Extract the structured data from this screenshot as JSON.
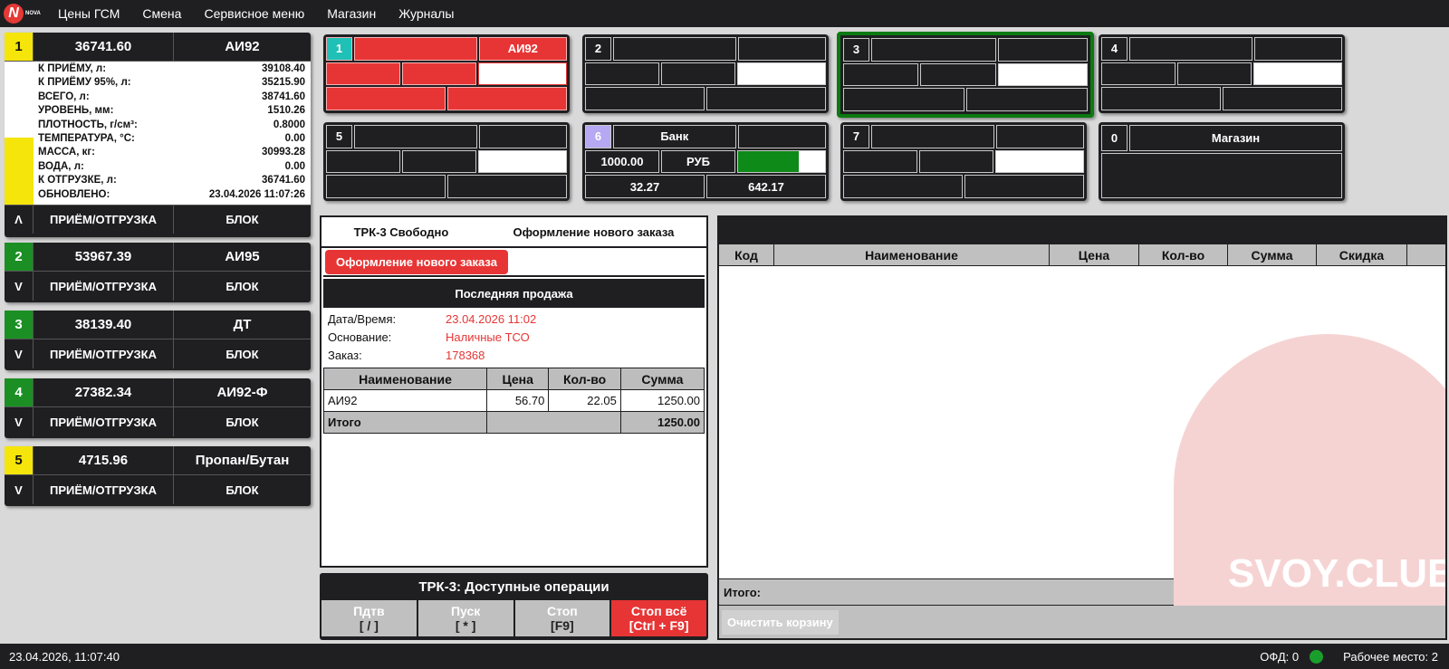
{
  "menu": {
    "logo_text": "NOVA",
    "logo_letter": "N",
    "items": [
      "Цены ГСМ",
      "Смена",
      "Сервисное меню",
      "Магазин",
      "Журналы"
    ]
  },
  "tanks": [
    {
      "num": "1",
      "volume": "36741.60",
      "fuel": "АИ92",
      "arrow": "Λ",
      "action": "ПРИЁМ/ОТГРУЗКА",
      "block": "БЛОК",
      "level_fraction": 0.47,
      "params": [
        {
          "k": "К ПРИЁМУ, л:",
          "v": "39108.40"
        },
        {
          "k": "К ПРИЁМУ 95%, л:",
          "v": "35215.90"
        },
        {
          "k": "ВСЕГО, л:",
          "v": "38741.60"
        },
        {
          "k": "УРОВЕНЬ, мм:",
          "v": "1510.26"
        },
        {
          "k": "ПЛОТНОСТЬ, г/см³:",
          "v": "0.8000"
        },
        {
          "k": "ТЕМПЕРАТУРА, °С:",
          "v": "0.00"
        },
        {
          "k": "МАССА, кг:",
          "v": "30993.28"
        },
        {
          "k": "ВОДА, л:",
          "v": "0.00"
        },
        {
          "k": "К ОТГРУЗКЕ, л:",
          "v": "36741.60"
        },
        {
          "k": "ОБНОВЛЕНО:",
          "v": "23.04.2026 11:07:26"
        }
      ]
    },
    {
      "num": "2",
      "volume": "53967.39",
      "fuel": "АИ95",
      "arrow": "V",
      "action": "ПРИЁМ/ОТГРУЗКА",
      "block": "БЛОК"
    },
    {
      "num": "3",
      "volume": "38139.40",
      "fuel": "ДТ",
      "arrow": "V",
      "action": "ПРИЁМ/ОТГРУЗКА",
      "block": "БЛОК"
    },
    {
      "num": "4",
      "volume": "27382.34",
      "fuel": "АИ92-Ф",
      "arrow": "V",
      "action": "ПРИЁМ/ОТГРУЗКА",
      "block": "БЛОК"
    },
    {
      "num": "5",
      "volume": "4715.96",
      "fuel": "Пропан/Бутан",
      "arrow": "V",
      "action": "ПРИЁМ/ОТГРУЗКА",
      "block": "БЛОК"
    }
  ],
  "tank_colors": {
    "1": "#f5e50a",
    "2": "#1b8f24",
    "3": "#1b8f24",
    "4": "#1b8f24",
    "5": "#f5e50a"
  },
  "pumps": {
    "p1": {
      "num": "1",
      "fuel": "АИ92"
    },
    "p2": {
      "num": "2"
    },
    "p3": {
      "num": "3"
    },
    "p4": {
      "num": "4"
    },
    "p5": {
      "num": "5"
    },
    "p6": {
      "num": "6",
      "label": "Банк",
      "amount": "1000.00",
      "currency": "РУБ",
      "progress": 0.7,
      "a": "32.27",
      "b": "642.17"
    },
    "p7": {
      "num": "7"
    },
    "p0": {
      "num": "0",
      "label": "Магазин"
    }
  },
  "order": {
    "status": "ТРК-3 Свободно",
    "mode": "Оформление нового заказа",
    "new_order_button": "Оформление нового заказа",
    "last_sale_title": "Последняя продажа",
    "info": [
      {
        "k": "Дата/Время:",
        "v": "23.04.2026 11:02"
      },
      {
        "k": "Основание:",
        "v": "Наличные ТСО"
      },
      {
        "k": "Заказ:",
        "v": "178368"
      }
    ],
    "table_headers": [
      "Наименование",
      "Цена",
      "Кол-во",
      "Сумма"
    ],
    "rows": [
      [
        "АИ92",
        "56.70",
        "22.05",
        "1250.00"
      ]
    ],
    "total_label": "Итого",
    "total_value": "1250.00"
  },
  "ops": {
    "title": "ТРК-3: Доступные операции",
    "buttons": [
      {
        "label": "Пдтв",
        "key": "[ / ]"
      },
      {
        "label": "Пуск",
        "key": "[ * ]"
      },
      {
        "label": "Стоп",
        "key": "[F9]"
      },
      {
        "label": "Стоп всё",
        "key": "[Ctrl + F9]"
      }
    ]
  },
  "cart": {
    "headers": [
      "Код",
      "Наименование",
      "Цена",
      "Кол-во",
      "Сумма",
      "Скидка"
    ],
    "total_label": "Итого:",
    "total_value": "-",
    "clear_button": "Очистить корзину",
    "watermark": "SVOY.CLUB"
  },
  "status": {
    "datetime": "23.04.2026, 11:07:40",
    "ofd": "ОФД: 0",
    "workplace": "Рабочее место: 2"
  }
}
